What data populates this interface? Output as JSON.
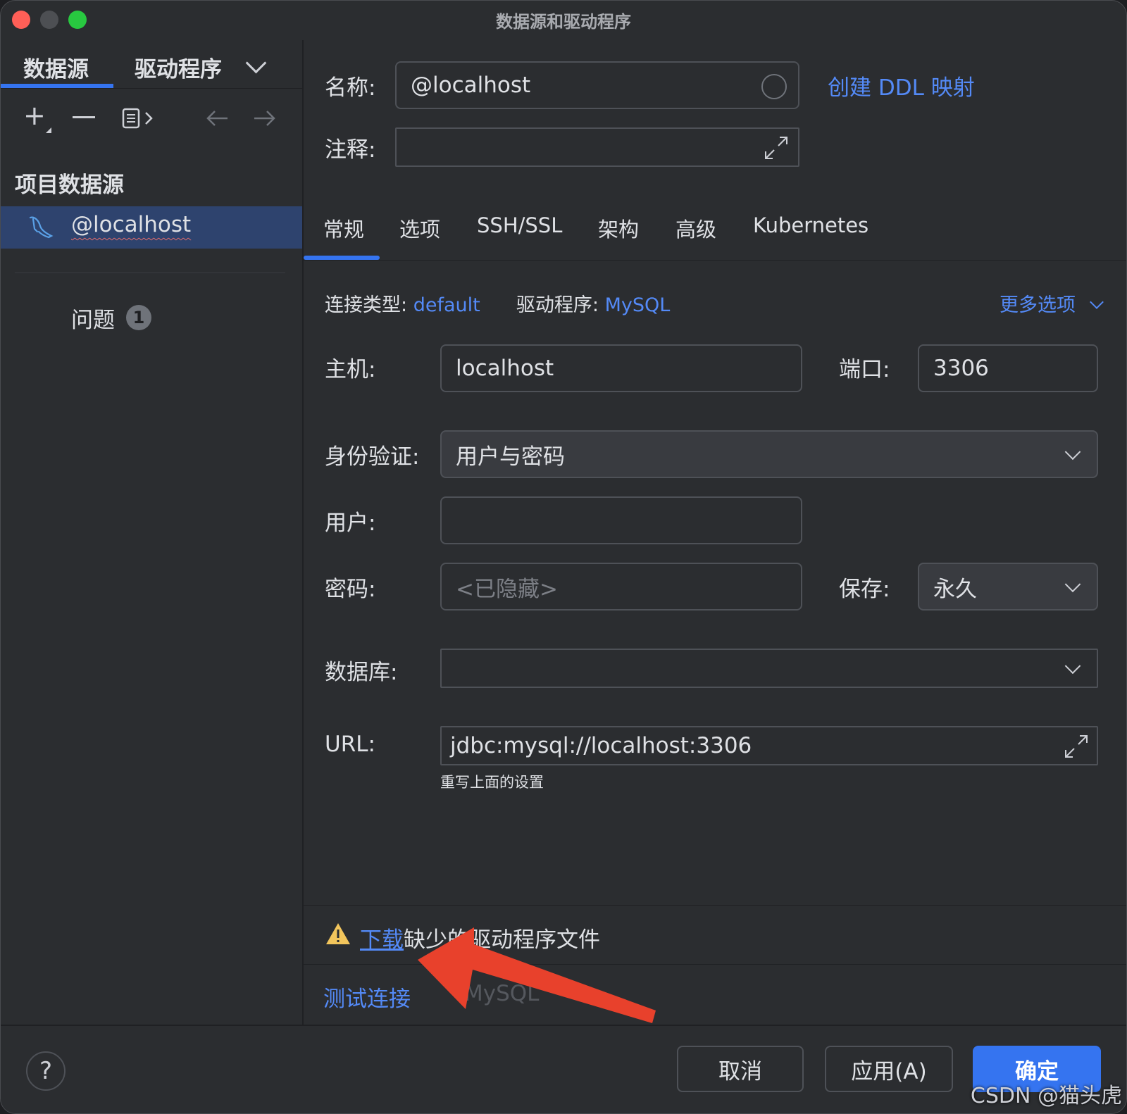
{
  "window": {
    "title": "数据源和驱动程序"
  },
  "left": {
    "tabs": [
      "数据源",
      "驱动程序"
    ],
    "section_title": "项目数据源",
    "datasource": "@localhost",
    "problems_label": "问题",
    "problems_count": "1"
  },
  "form": {
    "name_label": "名称:",
    "name_value": "@localhost",
    "ddl_link": "创建 DDL 映射",
    "comment_label": "注释:",
    "tabs": [
      "常规",
      "选项",
      "SSH/SSL",
      "架构",
      "高级",
      "Kubernetes"
    ],
    "conn_type_label": "连接类型:",
    "conn_type_value": "default",
    "driver_label": "驱动程序:",
    "driver_value": "MySQL",
    "more_options": "更多选项",
    "host_label": "主机:",
    "host_value": "localhost",
    "port_label": "端口:",
    "port_value": "3306",
    "auth_label": "身份验证:",
    "auth_value": "用户与密码",
    "user_label": "用户:",
    "user_value": "",
    "password_label": "密码:",
    "password_placeholder": "<已隐藏>",
    "save_label": "保存:",
    "save_value": "永久",
    "database_label": "数据库:",
    "database_value": "",
    "url_label": "URL:",
    "url_value": "jdbc:mysql://localhost:3306",
    "url_hint": "重写上面的设置",
    "warning_link": "下载",
    "warning_text": "缺少的驱动程序文件",
    "test_connection": "测试连接",
    "driver_footer": "MySQL"
  },
  "buttons": {
    "help": "?",
    "cancel": "取消",
    "apply": "应用(A)",
    "ok": "确定"
  },
  "watermark": "CSDN @猫头虎",
  "colors": {
    "accent": "#3574f0",
    "link": "#548af7",
    "selection": "#2e436e",
    "warning": "#f2c55c",
    "annotation_arrow": "#e8412c"
  }
}
